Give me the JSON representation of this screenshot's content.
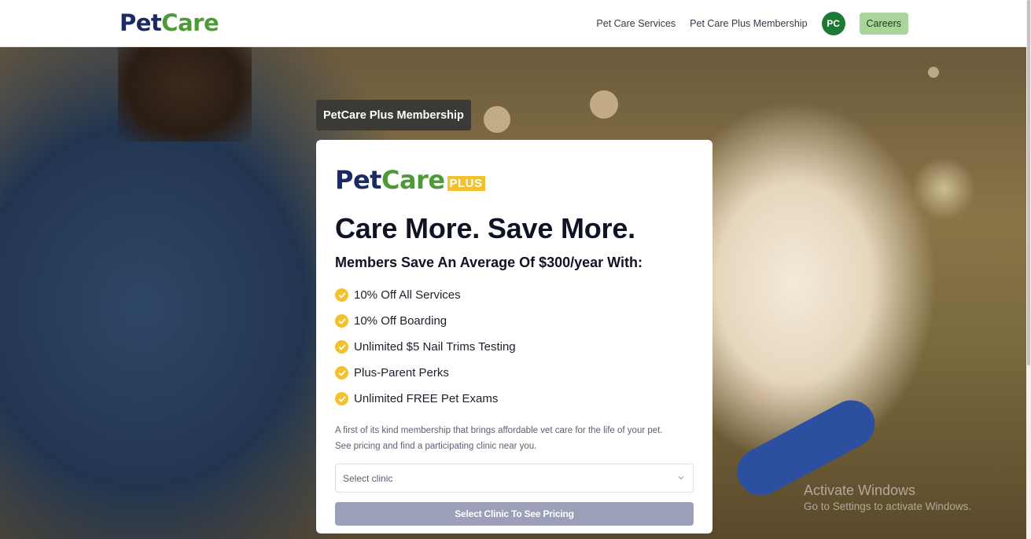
{
  "header": {
    "logo": {
      "pet": "Pet",
      "care": "Care"
    },
    "nav": {
      "services": "Pet Care Services",
      "membership": "Pet Care Plus Membership",
      "avatar": "PC",
      "careers": "Careers"
    }
  },
  "tag": "PetCare Plus Membership",
  "card": {
    "logo": {
      "pet": "Pet",
      "care": "Care",
      "plus": "PLUS"
    },
    "headline": "Care More. Save More.",
    "subhead": "Members Save An Average Of $300/year With:",
    "benefits": [
      "10% Off All Services",
      "10% Off Boarding",
      "Unlimited $5 Nail Trims Testing",
      "Plus-Parent Perks",
      "Unlimited FREE Pet Exams"
    ],
    "desc_line1": "A first of its kind membership that brings affordable vet care for the life of your pet.",
    "desc_line2": "See pricing and find a participating clinic near you.",
    "select_placeholder": "Select clinic",
    "price_button": "Select Clinic To See Pricing"
  },
  "watermark": {
    "line1": "Activate Windows",
    "line2": "Go to Settings to activate Windows."
  },
  "colors": {
    "brand_navy": "#1b2a63",
    "brand_green": "#4e9a3b",
    "accent_yellow": "#f2c12e",
    "avatar_green": "#1c7a34",
    "careers_bg": "#a9d49c",
    "button_disabled": "#9c9fb8"
  },
  "icons": {
    "check": "check-icon",
    "chevron": "chevron-down-icon"
  }
}
